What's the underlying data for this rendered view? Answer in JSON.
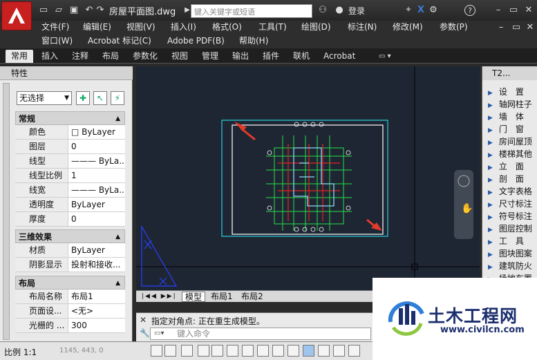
{
  "window": {
    "document_title": "房屋平面图.dwg",
    "search_placeholder": "键入关键字或短语",
    "login_label": "登录"
  },
  "menus": {
    "row1": [
      "文件(F)",
      "编辑(E)",
      "视图(V)",
      "插入(I)",
      "格式(O)",
      "工具(T)",
      "绘图(D)",
      "标注(N)",
      "修改(M)",
      "参数(P)"
    ],
    "row2": [
      "窗口(W)",
      "Acrobat 标记(C)",
      "Adobe PDF(B)",
      "帮助(H)"
    ]
  },
  "ribbon_tabs": [
    "常用",
    "插入",
    "注释",
    "布局",
    "参数化",
    "视图",
    "管理",
    "输出",
    "插件",
    "联机",
    "Acrobat"
  ],
  "properties": {
    "title": "特性",
    "selection": "无选择",
    "sections": [
      {
        "name": "常规",
        "rows": [
          {
            "key": "颜色",
            "value": "□ ByLayer"
          },
          {
            "key": "图层",
            "value": "0"
          },
          {
            "key": "线型",
            "value": "——— ByLa..."
          },
          {
            "key": "线型比例",
            "value": "1"
          },
          {
            "key": "线宽",
            "value": "——— ByLa..."
          },
          {
            "key": "透明度",
            "value": "ByLayer"
          },
          {
            "key": "厚度",
            "value": "0"
          }
        ]
      },
      {
        "name": "三维效果",
        "rows": [
          {
            "key": "材质",
            "value": "ByLayer"
          },
          {
            "key": "阴影显示",
            "value": "投射和接收..."
          }
        ]
      },
      {
        "name": "布局",
        "rows": [
          {
            "key": "布局名称",
            "value": "布局1"
          },
          {
            "key": "页面设...",
            "value": "<无>"
          },
          {
            "key": "光栅的 ...",
            "value": "300"
          }
        ]
      }
    ]
  },
  "layout_tabs": [
    "模型",
    "布局1",
    "布局2"
  ],
  "command": {
    "prompt": "指定对角点: 正在重生成模型。",
    "input_placeholder": "键入命令"
  },
  "tool_palette": {
    "title": "T2...",
    "items": [
      "设　置",
      "轴网柱子",
      "墙　体",
      "门　窗",
      "房间屋顶",
      "楼梯其他",
      "立　面",
      "剖　面",
      "文字表格",
      "尺寸标注",
      "符号标注",
      "图层控制",
      "工　具",
      "图块图案",
      "建筑防火",
      "场地布置"
    ]
  },
  "status": {
    "scale": "比例 1:1",
    "coords": "1145, 443, 0"
  },
  "watermark": {
    "title": "土木工程网",
    "url": "www.civilcn.com"
  },
  "colors": {
    "accent_red": "#c8201e",
    "canvas_bg": "#1f2633",
    "cyan": "#29d3e0",
    "green": "#26e04a",
    "red": "#e52222",
    "arrow_red": "#e23b2b"
  }
}
